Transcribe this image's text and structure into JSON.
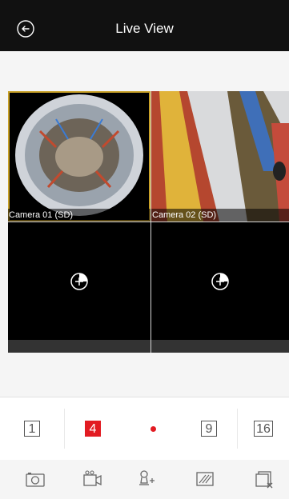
{
  "header": {
    "title": "Live View",
    "back_icon": "back-arrow-circle-icon"
  },
  "grid": {
    "cells": [
      {
        "label": "Camera 01 (SD)",
        "state": "live",
        "selected": true
      },
      {
        "label": "Camera 02 (SD)",
        "state": "live",
        "selected": false
      },
      {
        "label": "",
        "state": "empty",
        "icon": "add-circle-icon"
      },
      {
        "label": "",
        "state": "empty",
        "icon": "add-circle-icon"
      }
    ]
  },
  "layout_bar": {
    "items": [
      {
        "label": "1",
        "active": false
      },
      {
        "label": "4",
        "active": true
      },
      {
        "label": "",
        "icon": "record-dot-icon"
      },
      {
        "label": "9",
        "active": false
      },
      {
        "label": "16",
        "active": false
      }
    ]
  },
  "toolbar": {
    "items": [
      "camera-icon",
      "video-record-icon",
      "ptz-icon",
      "image-quality-icon",
      "close-all-icon"
    ]
  },
  "colors": {
    "accent": "#e21b22",
    "selected_border": "#c8a128",
    "header_bg": "#111111"
  }
}
